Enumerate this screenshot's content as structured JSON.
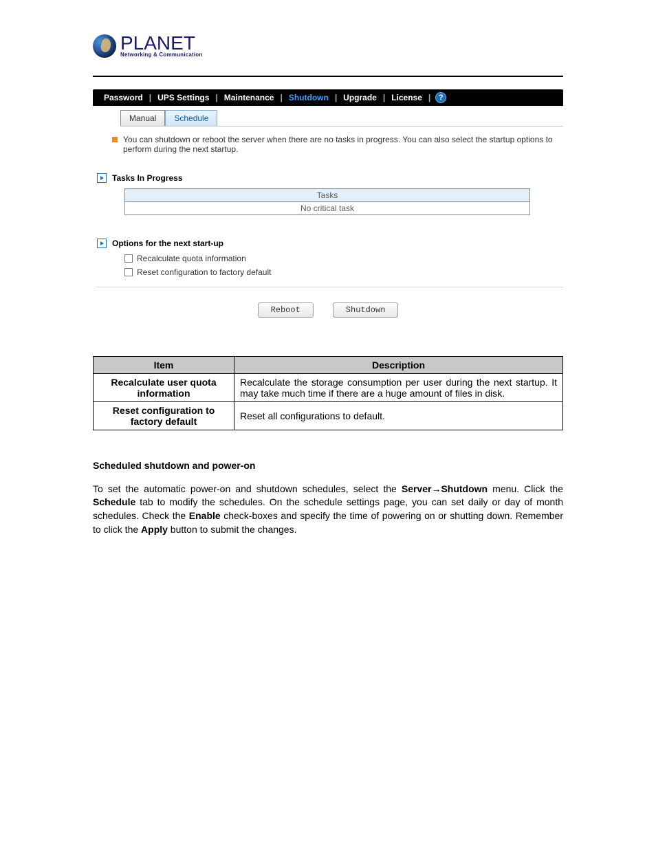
{
  "logo": {
    "brand": "PLANET",
    "tagline": "Networking & Communication"
  },
  "nav": {
    "items": [
      "Password",
      "UPS Settings",
      "Maintenance",
      "Shutdown",
      "Upgrade",
      "License"
    ],
    "active_index": 3
  },
  "tabs": {
    "items": [
      "Manual",
      "Schedule"
    ],
    "active_index": 0
  },
  "info_text": "You can shutdown or reboot the server when there are no tasks in progress. You can also select the startup options to perform during the next startup.",
  "tasks_section": {
    "title": "Tasks In Progress",
    "header": "Tasks",
    "row": "No critical task"
  },
  "options_section": {
    "title": "Options for the next start-up",
    "items": [
      "Recalculate quota information",
      "Reset configuration to factory default"
    ]
  },
  "buttons": {
    "reboot": "Reboot",
    "shutdown": "Shutdown"
  },
  "desc_table": {
    "head_item": "Item",
    "head_desc": "Description",
    "rows": [
      {
        "item": "Recalculate user quota information",
        "desc": "Recalculate the storage consumption per user during the next startup. It may take much time if there are a huge amount of files in disk."
      },
      {
        "item": "Reset configuration to factory default",
        "desc": "Reset all configurations to default."
      }
    ]
  },
  "body": {
    "heading": "Scheduled shutdown and power-on",
    "p1a": "To set the automatic power-on and shutdown schedules, select the ",
    "p1b": "Server→Shutdown",
    "p1c": " menu. Click the ",
    "p1d": "Schedule",
    "p1e": " tab to modify the schedules. On the schedule settings page, you can set daily or day of month schedules. Check the ",
    "p1f": "Enable",
    "p1g": " check-boxes and specify the time of powering on or shutting down. Remember to click the ",
    "p1h": "Apply",
    "p1i": " button to submit the changes."
  }
}
